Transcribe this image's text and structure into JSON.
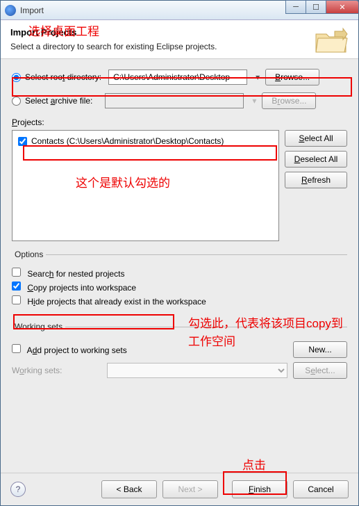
{
  "window": {
    "title": "Import"
  },
  "header": {
    "title": "Import Projects",
    "subtitle": "Select a directory to search for existing Eclipse projects."
  },
  "source": {
    "root_label_pre": "Select roo",
    "root_label_u": "t",
    "root_label_post": " directory:",
    "root_value": "C:\\Users\\Administrator\\Desktop",
    "root_browse": "Browse...",
    "archive_label_pre": "Select ",
    "archive_label_u": "a",
    "archive_label_post": "rchive file:",
    "archive_value": "",
    "archive_browse": "Browse..."
  },
  "projects": {
    "label_u": "P",
    "label_post": "rojects:",
    "items": [
      {
        "checked": true,
        "label": "Contacts (C:\\Users\\Administrator\\Desktop\\Contacts)"
      }
    ],
    "select_all_u": "S",
    "select_all_post": "elect All",
    "deselect_all_u": "D",
    "deselect_all_post": "eselect All",
    "refresh_u": "R",
    "refresh_post": "efresh"
  },
  "options": {
    "legend": "Options",
    "nested_pre": "Searc",
    "nested_u": "h",
    "nested_post": " for nested projects",
    "copy_u": "C",
    "copy_post": "opy projects into workspace",
    "hide_pre": "H",
    "hide_u": "i",
    "hide_post": "de projects that already exist in the workspace"
  },
  "ws": {
    "legend": "Working sets",
    "add_pre": "A",
    "add_u": "d",
    "add_post": "d project to working sets",
    "new": "New...",
    "label_pre": "W",
    "label_u": "o",
    "label_post": "rking sets:",
    "select_pre": "S",
    "select_u": "e",
    "select_post": "lect..."
  },
  "footer": {
    "back": "< Back",
    "next": "Next >",
    "finish_u": "F",
    "finish_post": "inish",
    "cancel": "Cancel"
  },
  "annotations": {
    "a1": "选择桌面工程",
    "a2": "这个是默认勾选的",
    "a3": "勾选此，代表将该项目copy到工作空间",
    "a4": "点击"
  }
}
